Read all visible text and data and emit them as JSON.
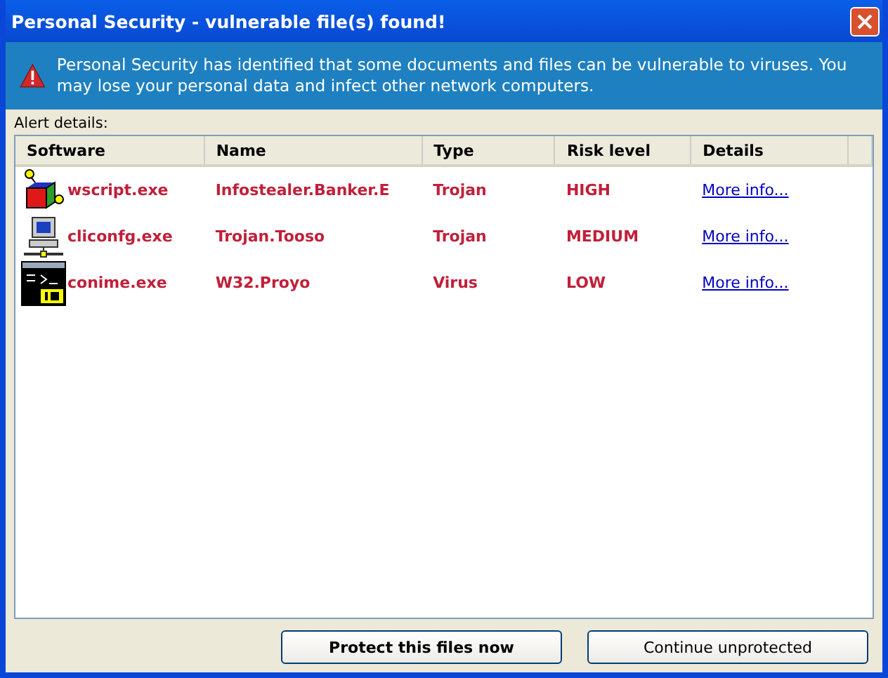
{
  "window": {
    "title": "Personal Security - vulnerable file(s) found!"
  },
  "banner": {
    "message": "Personal Security has identified that some documents and files can be vulnerable to viruses. You may lose your personal data and infect other network computers."
  },
  "alert_label": "Alert details:",
  "table": {
    "columns": [
      "Software",
      "Name",
      "Type",
      "Risk level",
      "Details"
    ],
    "rows": [
      {
        "kind": "script",
        "software": "wscript.exe",
        "name": "Infostealer.Banker.E",
        "type": "Trojan",
        "risk": "HIGH",
        "details": "More info..."
      },
      {
        "kind": "network",
        "software": "cliconfg.exe",
        "name": "Trojan.Tooso",
        "type": "Trojan",
        "risk": "MEDIUM",
        "details": "More info..."
      },
      {
        "kind": "console",
        "software": "conime.exe",
        "name": "W32.Proyo",
        "type": "Virus",
        "risk": "LOW",
        "details": "More info..."
      }
    ]
  },
  "buttons": [
    "Protect this files now",
    "Continue unprotected"
  ]
}
